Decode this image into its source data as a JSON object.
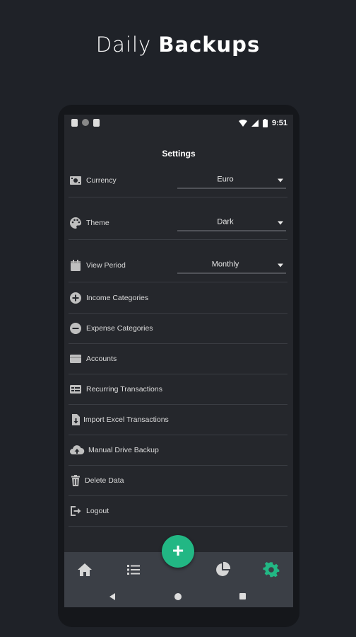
{
  "headline": {
    "prefix": "Daily",
    "bold": "Backups"
  },
  "status_bar": {
    "time": "9:51"
  },
  "screen_title": "Settings",
  "settings": {
    "currency": {
      "label": "Currency",
      "value": "Euro",
      "icon": "cash-icon"
    },
    "theme": {
      "label": "Theme",
      "value": "Dark",
      "icon": "palette-icon"
    },
    "view_period": {
      "label": "View Period",
      "value": "Monthly",
      "icon": "calendar-icon"
    }
  },
  "menu": {
    "income_categories": "Income Categories",
    "expense_categories": "Expense Categories",
    "accounts": "Accounts",
    "recurring_transactions": "Recurring Transactions",
    "import_excel": "Import Excel Transactions",
    "manual_drive_backup": "Manual Drive Backup",
    "delete_data": "Delete Data",
    "logout": "Logout"
  },
  "fab": {
    "symbol": "+"
  },
  "bottom_nav": {
    "active": "settings",
    "items": [
      "home",
      "transactions",
      "statistics",
      "settings"
    ]
  },
  "colors": {
    "accent": "#22b784",
    "background": "#25272c",
    "nav": "#3b3f46"
  }
}
